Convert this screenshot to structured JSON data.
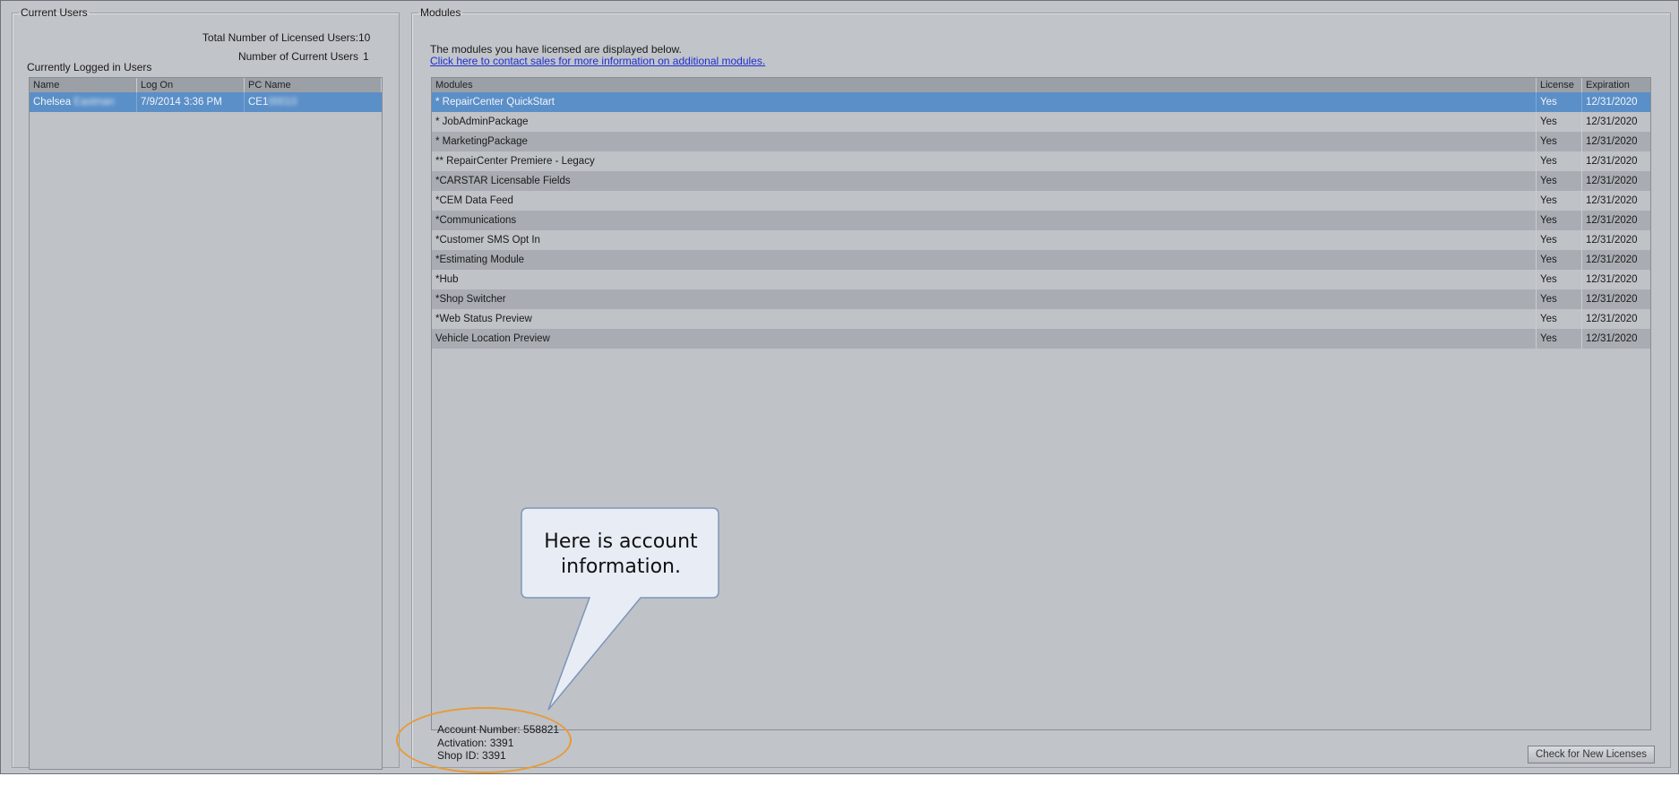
{
  "current_users": {
    "legend": "Current Users",
    "total_licensed_label": "Total Number of Licensed Users:",
    "total_licensed_value": "10",
    "current_count_label": "Number of Current Users",
    "current_count_value": "1",
    "logged_in_label": "Currently Logged in Users",
    "columns": [
      "Name",
      "Log On",
      "PC Name"
    ],
    "rows": [
      {
        "name_first": "Chelsea",
        "name_last": "Eastman",
        "logon": "7/9/2014 3:36 PM",
        "pc_prefix": "CE1",
        "pc_suffix": "00010"
      }
    ]
  },
  "modules": {
    "legend": "Modules",
    "intro": "The modules you have licensed are displayed below.",
    "contact_link": "Click here to contact sales for more information on additional modules.",
    "columns": [
      "Modules",
      "License",
      "Expiration"
    ],
    "rows": [
      {
        "name": "*  RepairCenter QuickStart",
        "license": "Yes",
        "expiration": "12/31/2020"
      },
      {
        "name": "* JobAdminPackage",
        "license": "Yes",
        "expiration": "12/31/2020"
      },
      {
        "name": "* MarketingPackage",
        "license": "Yes",
        "expiration": "12/31/2020"
      },
      {
        "name": "** RepairCenter Premiere - Legacy",
        "license": "Yes",
        "expiration": "12/31/2020"
      },
      {
        "name": "*CARSTAR Licensable Fields",
        "license": "Yes",
        "expiration": "12/31/2020"
      },
      {
        "name": "*CEM Data Feed",
        "license": "Yes",
        "expiration": "12/31/2020"
      },
      {
        "name": "*Communications",
        "license": "Yes",
        "expiration": "12/31/2020"
      },
      {
        "name": "*Customer SMS Opt In",
        "license": "Yes",
        "expiration": "12/31/2020"
      },
      {
        "name": "*Estimating Module",
        "license": "Yes",
        "expiration": "12/31/2020"
      },
      {
        "name": "*Hub",
        "license": "Yes",
        "expiration": "12/31/2020"
      },
      {
        "name": "*Shop Switcher",
        "license": "Yes",
        "expiration": "12/31/2020"
      },
      {
        "name": "*Web Status Preview",
        "license": "Yes",
        "expiration": "12/31/2020"
      },
      {
        "name": "Vehicle Location Preview",
        "license": "Yes",
        "expiration": "12/31/2020"
      }
    ],
    "check_button": "Check for New Licenses"
  },
  "account": {
    "account_number": "Account Number: 558821",
    "activation": "Activation: 3391",
    "shop_id": "Shop ID: 3391"
  },
  "callout": {
    "line1": "Here is account",
    "line2": "information.",
    "highlight_color": "#e89a36"
  },
  "colors": {
    "window_bg": "#c1c4c9",
    "selected_row": "#5b8fc7",
    "link": "#1e2fd0"
  }
}
